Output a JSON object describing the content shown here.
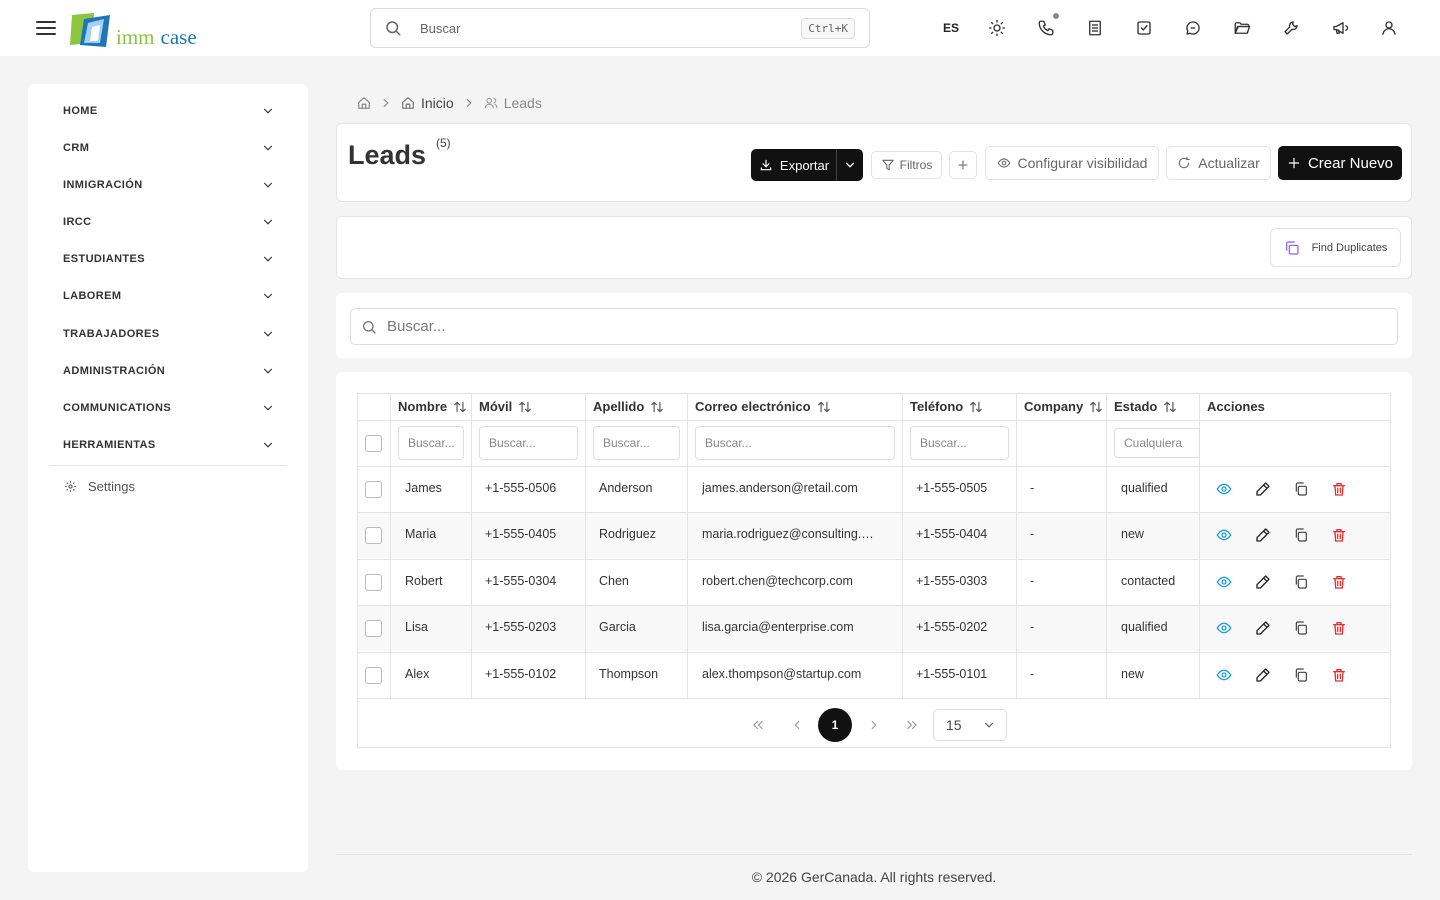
{
  "topbar": {
    "logo_part1": "imm",
    "logo_part2": "case",
    "search_placeholder": "Buscar",
    "search_shortcut": "Ctrl+K",
    "language": "ES",
    "icons": [
      "sun-icon",
      "phone-icon",
      "notes-icon",
      "tasks-icon",
      "chat-icon",
      "folder-icon",
      "wrench-icon",
      "megaphone-icon",
      "user-icon"
    ]
  },
  "sidebar": {
    "items": [
      {
        "label": "HOME"
      },
      {
        "label": "CRM"
      },
      {
        "label": "INMIGRACIÓN"
      },
      {
        "label": "IRCC"
      },
      {
        "label": "ESTUDIANTES"
      },
      {
        "label": "LABOREM"
      },
      {
        "label": "TRABAJADORES"
      },
      {
        "label": "ADMINISTRACIÓN"
      },
      {
        "label": "COMMUNICATIONS"
      },
      {
        "label": "HERRAMIENTAS"
      }
    ],
    "settings_label": "Settings"
  },
  "breadcrumb": {
    "inicio": "Inicio",
    "current": "Leads"
  },
  "header": {
    "title": "Leads",
    "count": "(5)",
    "export_label": "Exportar",
    "filters_label": "Filtros",
    "visibility_label": "Configurar visibilidad",
    "refresh_label": "Actualizar",
    "create_label": "Crear Nuevo"
  },
  "tools": {
    "find_duplicates_label": "Find Duplicates"
  },
  "search": {
    "placeholder": "Buscar..."
  },
  "table": {
    "columns": {
      "nombre": "Nombre",
      "movil": "Móvil",
      "apellido": "Apellido",
      "correo": "Correo electrónico",
      "telefono": "Teléfono",
      "company": "Company",
      "estado": "Estado",
      "acciones": "Acciones"
    },
    "filter_placeholder": "Buscar...",
    "estado_filter_placeholder": "Cualquiera",
    "rows": [
      {
        "nombre": "James",
        "movil": "+1-555-0506",
        "apellido": "Anderson",
        "correo": "james.anderson@retail.com",
        "telefono": "+1-555-0505",
        "company": "-",
        "estado": "qualified"
      },
      {
        "nombre": "Maria",
        "movil": "+1-555-0405",
        "apellido": "Rodriguez",
        "correo": "maria.rodriguez@consulting.com",
        "telefono": "+1-555-0404",
        "company": "-",
        "estado": "new"
      },
      {
        "nombre": "Robert",
        "movil": "+1-555-0304",
        "apellido": "Chen",
        "correo": "robert.chen@techcorp.com",
        "telefono": "+1-555-0303",
        "company": "-",
        "estado": "contacted"
      },
      {
        "nombre": "Lisa",
        "movil": "+1-555-0203",
        "apellido": "Garcia",
        "correo": "lisa.garcia@enterprise.com",
        "telefono": "+1-555-0202",
        "company": "-",
        "estado": "qualified"
      },
      {
        "nombre": "Alex",
        "movil": "+1-555-0102",
        "apellido": "Thompson",
        "correo": "alex.thompson@startup.com",
        "telefono": "+1-555-0101",
        "company": "-",
        "estado": "new"
      }
    ]
  },
  "pagination": {
    "current_page": "1",
    "page_size": "15"
  },
  "footer": {
    "text": "© 2026 GerCanada. All rights reserved."
  },
  "colors": {
    "accent": "#111111",
    "view_icon": "#1a9fd6",
    "delete_icon": "#e03131",
    "duplicates_icon": "#8b5cf6",
    "logo_green": "#8cc63f",
    "logo_blue": "#1f75b8"
  }
}
